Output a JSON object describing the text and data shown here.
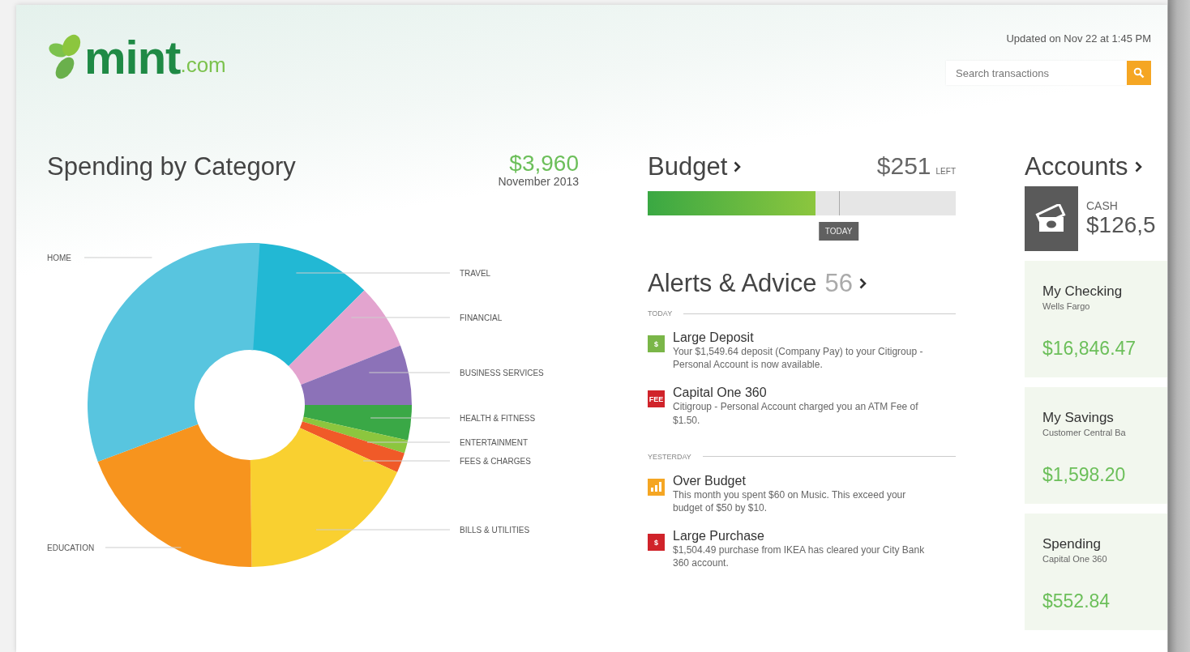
{
  "logo": {
    "word": "mint",
    "suffix": ".com"
  },
  "header": {
    "updated": "Updated on Nov 22 at 1:45 PM",
    "search": {
      "placeholder": "Search transactions"
    }
  },
  "spending": {
    "title": "Spending by Category",
    "total": "$3,960",
    "period": "November 2013",
    "categories": [
      {
        "label": "TRAVEL",
        "color": "#22b8d4"
      },
      {
        "label": "FINANCIAL",
        "color": "#e3a4cf"
      },
      {
        "label": "BUSINESS SERVICES",
        "color": "#8c72b8"
      },
      {
        "label": "HEALTH & FITNESS",
        "color": "#3aa846"
      },
      {
        "label": "ENTERTAINMENT",
        "color": "#8cc63e"
      },
      {
        "label": "FEES & CHARGES",
        "color": "#f05a28"
      },
      {
        "label": "BILLS & UTILITIES",
        "color": "#f9d030"
      },
      {
        "label": "EDUCATION",
        "color": "#f7941e"
      },
      {
        "label": "HOME",
        "color": "#58c5df"
      }
    ]
  },
  "budget": {
    "title": "Budget",
    "amount": "$251",
    "suffix": "LEFT",
    "level": 0.545,
    "today": {
      "label": "TODAY",
      "level": 0.62
    }
  },
  "alerts": {
    "title": "Alerts & Advice",
    "count": "56",
    "groups": [
      {
        "label": "TODAY",
        "items": [
          {
            "kind": "deposit",
            "badge": "$",
            "title": "Large Deposit",
            "text": "Your $1,549.64 deposit (Company Pay) to your Citigroup - Personal Account is now available."
          },
          {
            "kind": "fee",
            "badge": "FEE",
            "title": "Capital One 360",
            "text": "Citigroup - Personal Account charged you an ATM Fee of $1.50."
          }
        ]
      },
      {
        "label": "YESTERDAY",
        "items": [
          {
            "kind": "budget",
            "title": "Over Budget",
            "text": "This month you spent $60 on Music. This exceed your budget of $50 by $10."
          },
          {
            "kind": "purchase",
            "badge": "$",
            "title": "Large Purchase",
            "text": "$1,504.49 purchase from IKEA has cleared your City Bank 360 account."
          }
        ]
      }
    ]
  },
  "accounts": {
    "title": "Accounts",
    "cash": {
      "label": "CASH",
      "amount": "$126,5"
    },
    "cards": [
      {
        "name": "My Checking",
        "bank": "Wells Fargo",
        "amount": "$16,846.47"
      },
      {
        "name": "My Savings",
        "bank": "Customer Central Ba",
        "amount": "$1,598.20"
      },
      {
        "name": "Spending",
        "bank": "Capital One 360",
        "amount": "$552.84"
      }
    ]
  }
}
